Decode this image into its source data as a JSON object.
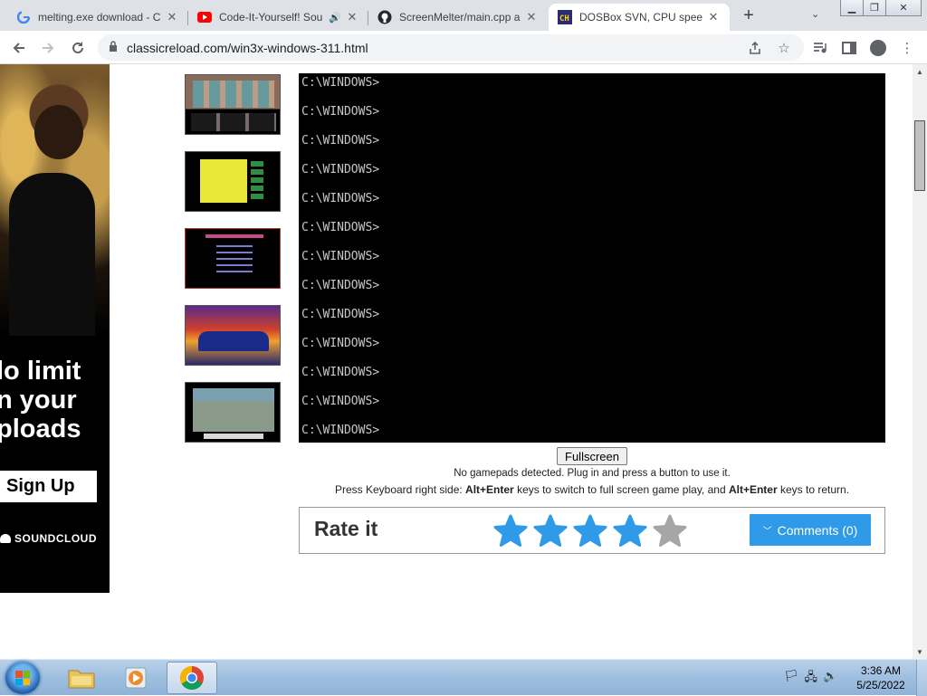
{
  "tabs": [
    {
      "title": "melting.exe download - C",
      "favicon": "google-icon",
      "active": false
    },
    {
      "title": "Code-It-Yourself! Sou",
      "favicon": "youtube-icon",
      "active": false,
      "audio": true
    },
    {
      "title": "ScreenMelter/main.cpp a",
      "favicon": "github-icon",
      "active": false
    },
    {
      "title": "DOSBox SVN, CPU speed:",
      "favicon": "dosbox-icon",
      "active": true
    }
  ],
  "address": {
    "url": "classicreload.com/win3x-windows-311.html"
  },
  "ad": {
    "headline": "lo limit\nn your\nploads",
    "signup_label": "Sign Up",
    "brand": "SOUNDCLOUD"
  },
  "dos": {
    "lines": [
      "C:\\WINDOWS>",
      "C:\\WINDOWS>",
      "C:\\WINDOWS>",
      "C:\\WINDOWS>",
      "C:\\WINDOWS>",
      "C:\\WINDOWS>",
      "C:\\WINDOWS>",
      "C:\\WINDOWS>",
      "C:\\WINDOWS>",
      "C:\\WINDOWS>",
      "C:\\WINDOWS>",
      "C:\\WINDOWS>",
      "C:\\WINDOWS>"
    ]
  },
  "player": {
    "fullscreen_label": "Fullscreen",
    "gamepad_msg": "No gamepads detected. Plug in and press a button to use it.",
    "keys_pre": "Press Keyboard right side: ",
    "keys_combo_1": "Alt+Enter",
    "keys_mid": " keys to switch to full screen game play, and ",
    "keys_combo_2": "Alt+Enter",
    "keys_post": " keys to return."
  },
  "rating": {
    "label": "Rate it",
    "stars_filled": 4,
    "stars_total": 5,
    "comments_label": "Comments (0)",
    "accent_color": "#2f9ae8"
  },
  "taskbar": {
    "time": "3:36 AM",
    "date": "5/25/2022"
  }
}
